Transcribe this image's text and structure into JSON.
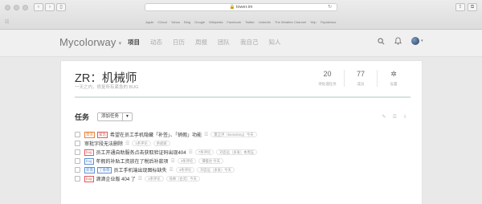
{
  "browser": {
    "url": "tower.im",
    "bookmarks": [
      "Apple",
      "iCloud",
      "Yahoo",
      "Bing",
      "Google",
      "Wikipedia",
      "Facebook",
      "Twitter",
      "LinkedIn",
      "The Weather Channel",
      "Yelp",
      "TripAdvisor"
    ]
  },
  "header": {
    "brand": "Mycolorway",
    "nav": [
      "项目",
      "动态",
      "日历",
      "周报",
      "团队",
      "我自己",
      "知人"
    ],
    "active_nav_index": 0
  },
  "project": {
    "title": "ZR：机械师",
    "description": "一天之内，修复所有紧急的 BUG",
    "stats": [
      {
        "value": "20",
        "label": "待处理任务"
      },
      {
        "value": "77",
        "label": "成员"
      },
      {
        "value": "",
        "label": "设置"
      }
    ]
  },
  "tasks": {
    "title": "任务",
    "add_label": "添加任务",
    "items": [
      {
        "tags": [
          {
            "text": "需求",
            "color": "#e8833a"
          },
          {
            "text": "紧急",
            "color": "#e05a5a"
          }
        ],
        "text": "希望在员工手机隐藏「补签」、「销假」功能",
        "pills": [
          "夏正洪（beandong）今天"
        ]
      },
      {
        "tags": [],
        "text": "审批字段无法删除",
        "pills": [
          "1条评论",
          "余斌斌"
        ]
      },
      {
        "tags": [
          {
            "text": "bug",
            "color": "#e05a5a"
          }
        ],
        "text": "员工开通自助服务点击获取验证码出现404",
        "pills": [
          "7条评论",
          "刘吾远（多发）本周五"
        ]
      },
      {
        "tags": [
          {
            "text": "bug",
            "color": "#5b8fd6"
          }
        ],
        "text": "年假的补贴工资放在了税后补款项",
        "pills": [
          "4条评论",
          "谭俊达 今天"
        ]
      },
      {
        "tags": [
          {
            "text": "新需",
            "color": "#5b8fd6"
          },
          {
            "text": "丁春霖",
            "color": "#5b8fd6"
          }
        ],
        "text": "员工手机端出现图标缺失",
        "pills": [
          "3条评论",
          "刘吾远（多发）今天"
        ]
      },
      {
        "tags": [
          {
            "text": "bug",
            "color": "#e05a5a"
          }
        ],
        "text": "滴滴企业版 404 了",
        "pills": [
          "1条评论",
          "徐帅（古灵）今天"
        ]
      }
    ]
  }
}
